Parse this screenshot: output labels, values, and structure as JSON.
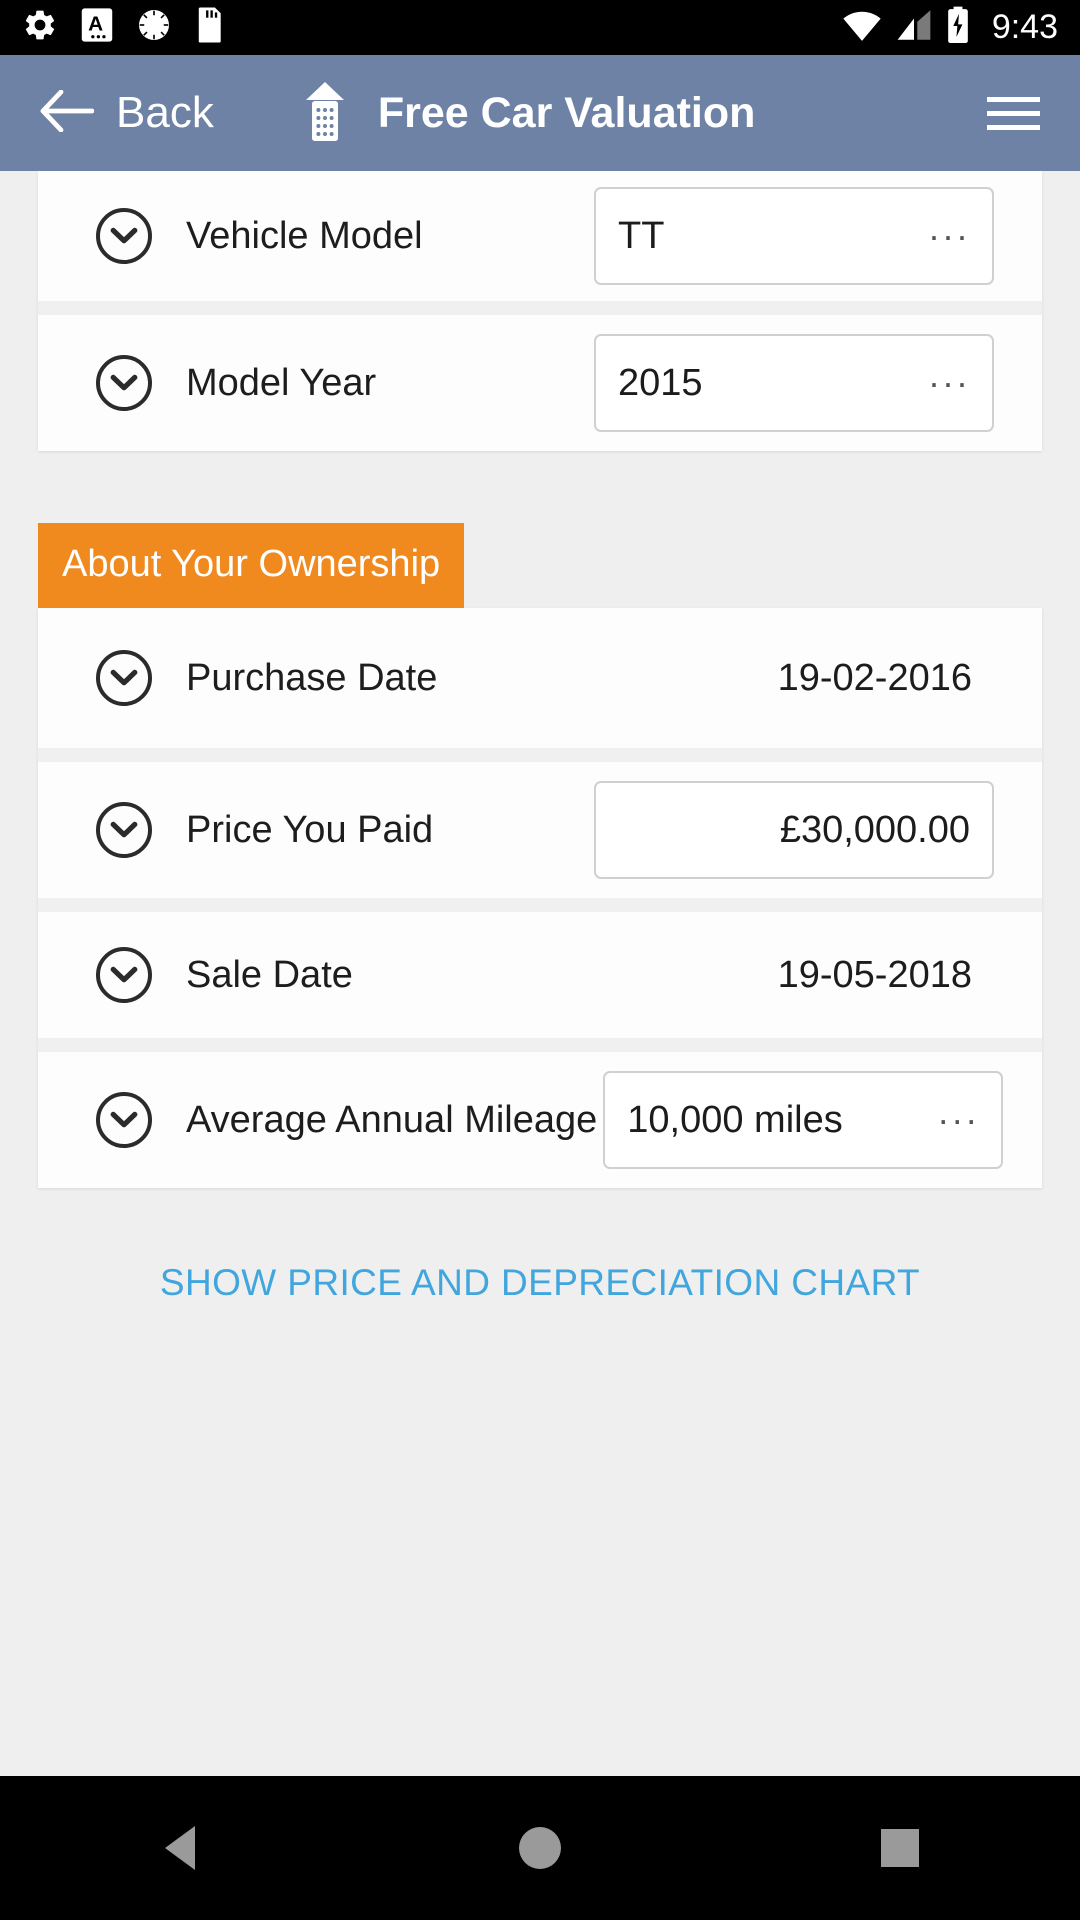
{
  "status_bar": {
    "time": "9:43",
    "left_icons": [
      "settings-gear-icon",
      "a-badge-icon",
      "sync-circle-icon",
      "sd-card-icon"
    ],
    "right_icons": [
      "wifi-icon",
      "cellular-signal-icon",
      "battery-charging-icon"
    ]
  },
  "app_bar": {
    "back_label": "Back",
    "back_icon": "arrow-left-icon",
    "home_icon": "home-icon",
    "title": "Free Car Valuation",
    "menu_icon": "hamburger-menu-icon"
  },
  "vehicle_section": {
    "rows": [
      {
        "label": "Vehicle Model",
        "value": "TT",
        "value_style": "input-left",
        "overflow": "···",
        "expand_icon": "chevron-down-circle-icon"
      },
      {
        "label": "Model Year",
        "value": "2015",
        "value_style": "input-left",
        "overflow": "···",
        "expand_icon": "chevron-down-circle-icon"
      }
    ]
  },
  "ownership_section": {
    "banner": "About Your Ownership",
    "banner_color": "#f08a1f",
    "rows": [
      {
        "label": "Purchase Date",
        "value": "19-02-2016",
        "value_style": "plain",
        "overflow": "",
        "expand_icon": "chevron-down-circle-icon"
      },
      {
        "label": "Price You Paid",
        "value": "£30,000.00",
        "value_style": "input-right",
        "overflow": "",
        "expand_icon": "chevron-down-circle-icon"
      },
      {
        "label": "Sale Date",
        "value": "19-05-2018",
        "value_style": "plain",
        "overflow": "",
        "expand_icon": "chevron-down-circle-icon"
      },
      {
        "label": "Average Annual Mileage",
        "value": "10,000 miles",
        "value_style": "input-left",
        "overflow": "···",
        "expand_icon": "chevron-down-circle-icon"
      }
    ]
  },
  "footer": {
    "chart_link": "SHOW PRICE AND DEPRECIATION CHART",
    "link_color": "#41a6dd"
  },
  "nav_bar": {
    "back_icon": "nav-back-triangle-icon",
    "home_icon": "nav-home-circle-icon",
    "recents_icon": "nav-recents-square-icon"
  }
}
